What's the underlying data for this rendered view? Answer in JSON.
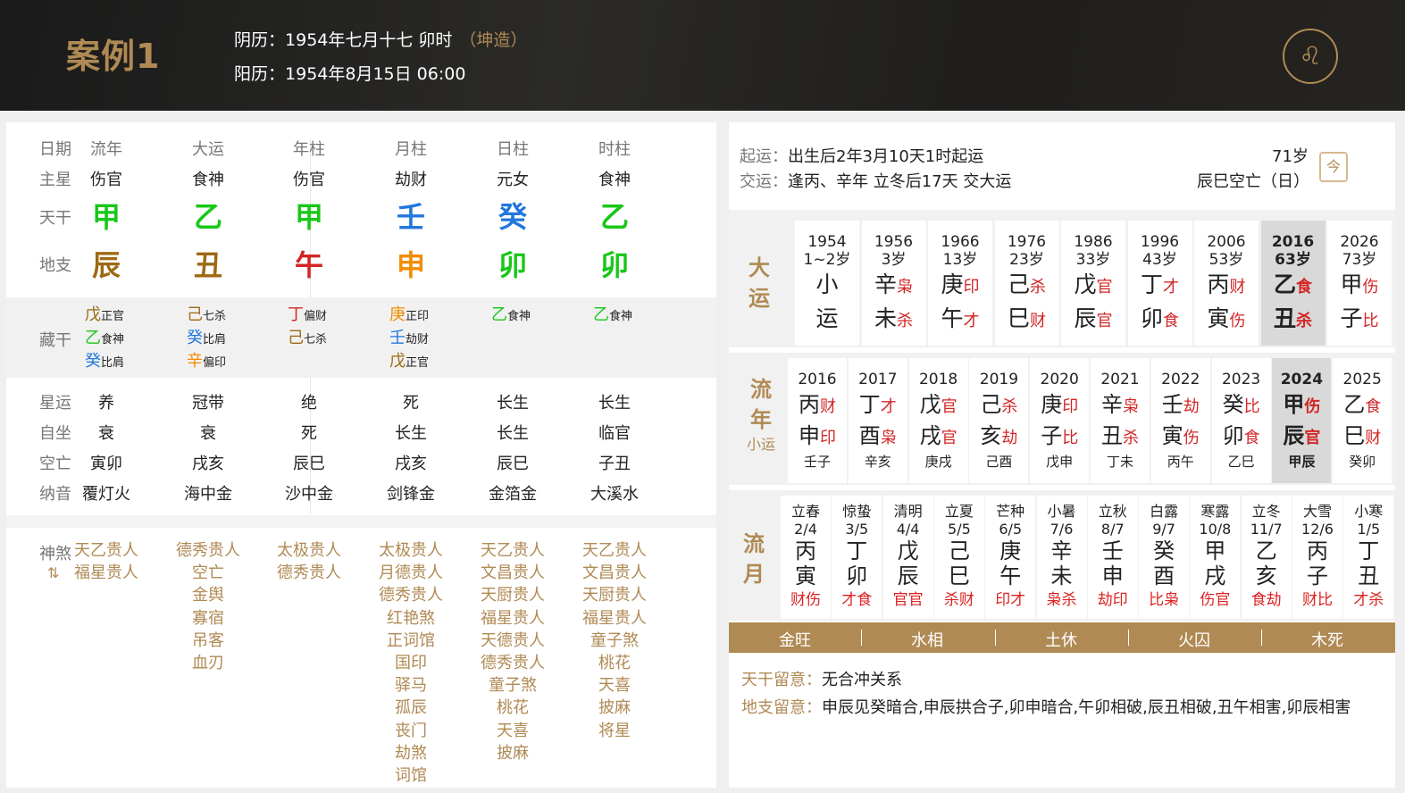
{
  "header": {
    "title": "案例1",
    "lunar_label": "阴历：",
    "lunar": "1954年七月十七 卯时",
    "gender": "（坤造）",
    "solar_label": "阳历：",
    "solar": "1954年8月15日 06:00",
    "logo": "lion-logo-icon"
  },
  "labels": {
    "riqi": "日期",
    "zhuxing": "主星",
    "tiangan": "天干",
    "dizhi": "地支",
    "canggan": "藏干",
    "xingyun": "星运",
    "zizuo": "自坐",
    "kongwang": "空亡",
    "nayin": "纳音",
    "shensha": "神煞",
    "shensha_icon": "⇅"
  },
  "pillars": [
    {
      "name": "流年",
      "zhu": "伤官",
      "gan": "甲",
      "gc": "grn",
      "zhi": "辰",
      "zc": "brn",
      "hidden": [
        [
          "戊",
          "brn",
          "正官"
        ],
        [
          "乙",
          "grn",
          "食神"
        ],
        [
          "癸",
          "blu",
          "比肩"
        ]
      ],
      "xingyun": "养",
      "zizuo": "衰",
      "kong": "寅卯",
      "nayin": "覆灯火",
      "ss": [
        "天乙贵人",
        "福星贵人"
      ]
    },
    {
      "name": "大运",
      "zhu": "食神",
      "gan": "乙",
      "gc": "grn",
      "zhi": "丑",
      "zc": "brn",
      "hidden": [
        [
          "己",
          "brn",
          "七杀"
        ],
        [
          "癸",
          "blu",
          "比肩"
        ],
        [
          "辛",
          "org",
          "偏印"
        ]
      ],
      "xingyun": "冠带",
      "zizuo": "衰",
      "kong": "戌亥",
      "nayin": "海中金",
      "ss": [
        "德秀贵人",
        "空亡",
        "金舆",
        "寡宿",
        "吊客",
        "血刃"
      ]
    },
    {
      "name": "年柱",
      "zhu": "伤官",
      "gan": "甲",
      "gc": "grn",
      "zhi": "午",
      "zc": "red",
      "hidden": [
        [
          "丁",
          "red",
          "偏财"
        ],
        [
          "己",
          "brn",
          "七杀"
        ]
      ],
      "xingyun": "绝",
      "zizuo": "死",
      "kong": "辰巳",
      "nayin": "沙中金",
      "ss": [
        "太极贵人",
        "德秀贵人"
      ]
    },
    {
      "name": "月柱",
      "zhu": "劫财",
      "gan": "壬",
      "gc": "blu",
      "zhi": "申",
      "zc": "org",
      "hidden": [
        [
          "庚",
          "org",
          "正印"
        ],
        [
          "壬",
          "blu",
          "劫财"
        ],
        [
          "戊",
          "brn",
          "正官"
        ]
      ],
      "xingyun": "死",
      "zizuo": "长生",
      "kong": "戌亥",
      "nayin": "剑锋金",
      "ss": [
        "太极贵人",
        "月德贵人",
        "德秀贵人",
        "红艳煞",
        "正词馆",
        "国印",
        "驿马",
        "孤辰",
        "丧门",
        "劫煞",
        "词馆"
      ]
    },
    {
      "name": "日柱",
      "zhu": "元女",
      "gan": "癸",
      "gc": "blu",
      "zhi": "卯",
      "zc": "grn",
      "hidden": [
        [
          "乙",
          "grn",
          "食神"
        ]
      ],
      "xingyun": "长生",
      "zizuo": "长生",
      "kong": "辰巳",
      "nayin": "金箔金",
      "ss": [
        "天乙贵人",
        "文昌贵人",
        "天厨贵人",
        "福星贵人",
        "天德贵人",
        "德秀贵人",
        "童子煞",
        "桃花",
        "天喜",
        "披麻"
      ]
    },
    {
      "name": "时柱",
      "zhu": "食神",
      "gan": "乙",
      "gc": "grn",
      "zhi": "卯",
      "zc": "grn",
      "hidden": [
        [
          "乙",
          "grn",
          "食神"
        ]
      ],
      "xingyun": "长生",
      "zizuo": "临官",
      "kong": "子丑",
      "nayin": "大溪水",
      "ss": [
        "天乙贵人",
        "文昌贵人",
        "天厨贵人",
        "福星贵人",
        "童子煞",
        "桃花",
        "天喜",
        "披麻",
        "将星"
      ]
    }
  ],
  "yun": {
    "qi_label": "起运：",
    "qi": "出生后2年3月10天1时起运",
    "jiao_label": "交运：",
    "jiao": "逢丙、辛年 立冬后17天 交大运",
    "age": "71岁",
    "kong": "辰巳空亡（日）",
    "calendar_icon": "今"
  },
  "dayun_label": [
    "大",
    "运"
  ],
  "dayun": [
    {
      "yr": "1954",
      "age": "1~2岁",
      "g": "小",
      "gs": "",
      "z": "运",
      "zs": ""
    },
    {
      "yr": "1956",
      "age": "3岁",
      "g": "辛",
      "gs": "枭",
      "z": "未",
      "zs": "杀"
    },
    {
      "yr": "1966",
      "age": "13岁",
      "g": "庚",
      "gs": "印",
      "z": "午",
      "zs": "才"
    },
    {
      "yr": "1976",
      "age": "23岁",
      "g": "己",
      "gs": "杀",
      "z": "巳",
      "zs": "财"
    },
    {
      "yr": "1986",
      "age": "33岁",
      "g": "戊",
      "gs": "官",
      "z": "辰",
      "zs": "官"
    },
    {
      "yr": "1996",
      "age": "43岁",
      "g": "丁",
      "gs": "才",
      "z": "卯",
      "zs": "食"
    },
    {
      "yr": "2006",
      "age": "53岁",
      "g": "丙",
      "gs": "财",
      "z": "寅",
      "zs": "伤"
    },
    {
      "yr": "2016",
      "age": "63岁",
      "g": "乙",
      "gs": "食",
      "z": "丑",
      "zs": "杀",
      "sel": true
    },
    {
      "yr": "2026",
      "age": "73岁",
      "g": "甲",
      "gs": "伤",
      "z": "子",
      "zs": "比"
    }
  ],
  "liunian_label": [
    "流",
    "年",
    "小运"
  ],
  "liunian": [
    {
      "yr": "2016",
      "g": "丙",
      "gs": "财",
      "z": "申",
      "zs": "印",
      "x": "壬子"
    },
    {
      "yr": "2017",
      "g": "丁",
      "gs": "才",
      "z": "酉",
      "zs": "枭",
      "x": "辛亥"
    },
    {
      "yr": "2018",
      "g": "戊",
      "gs": "官",
      "z": "戌",
      "zs": "官",
      "x": "庚戌"
    },
    {
      "yr": "2019",
      "g": "己",
      "gs": "杀",
      "z": "亥",
      "zs": "劫",
      "x": "己酉"
    },
    {
      "yr": "2020",
      "g": "庚",
      "gs": "印",
      "z": "子",
      "zs": "比",
      "x": "戊申"
    },
    {
      "yr": "2021",
      "g": "辛",
      "gs": "枭",
      "z": "丑",
      "zs": "杀",
      "x": "丁未"
    },
    {
      "yr": "2022",
      "g": "壬",
      "gs": "劫",
      "z": "寅",
      "zs": "伤",
      "x": "丙午"
    },
    {
      "yr": "2023",
      "g": "癸",
      "gs": "比",
      "z": "卯",
      "zs": "食",
      "x": "乙巳"
    },
    {
      "yr": "2024",
      "g": "甲",
      "gs": "伤",
      "z": "辰",
      "zs": "官",
      "x": "甲辰",
      "sel": true
    },
    {
      "yr": "2025",
      "g": "乙",
      "gs": "食",
      "z": "巳",
      "zs": "财",
      "x": "癸卯"
    }
  ],
  "liuyue_label": [
    "流",
    "月"
  ],
  "liuyue": [
    {
      "jq": "立春",
      "dt": "2/4",
      "g": "丙",
      "z": "寅",
      "ss": "财伤"
    },
    {
      "jq": "惊蛰",
      "dt": "3/5",
      "g": "丁",
      "z": "卯",
      "ss": "才食"
    },
    {
      "jq": "清明",
      "dt": "4/4",
      "g": "戊",
      "z": "辰",
      "ss": "官官"
    },
    {
      "jq": "立夏",
      "dt": "5/5",
      "g": "己",
      "z": "巳",
      "ss": "杀财"
    },
    {
      "jq": "芒种",
      "dt": "6/5",
      "g": "庚",
      "z": "午",
      "ss": "印才"
    },
    {
      "jq": "小暑",
      "dt": "7/6",
      "g": "辛",
      "z": "未",
      "ss": "枭杀"
    },
    {
      "jq": "立秋",
      "dt": "8/7",
      "g": "壬",
      "z": "申",
      "ss": "劫印"
    },
    {
      "jq": "白露",
      "dt": "9/7",
      "g": "癸",
      "z": "酉",
      "ss": "比枭"
    },
    {
      "jq": "寒露",
      "dt": "10/8",
      "g": "甲",
      "z": "戌",
      "ss": "伤官"
    },
    {
      "jq": "立冬",
      "dt": "11/7",
      "g": "乙",
      "z": "亥",
      "ss": "食劫"
    },
    {
      "jq": "大雪",
      "dt": "12/6",
      "g": "丙",
      "z": "子",
      "ss": "财比"
    },
    {
      "jq": "小寒",
      "dt": "1/5",
      "g": "丁",
      "z": "丑",
      "ss": "才杀"
    }
  ],
  "wuxing": [
    "金旺",
    "水相",
    "土休",
    "火囚",
    "木死"
  ],
  "liuyi": {
    "tg_label": "天干留意：",
    "tg": "无合冲关系",
    "dz_label": "地支留意：",
    "dz": "申辰见癸暗合,申辰拱合子,卯申暗合,午卯相破,辰丑相破,丑午相害,卯辰相害"
  }
}
